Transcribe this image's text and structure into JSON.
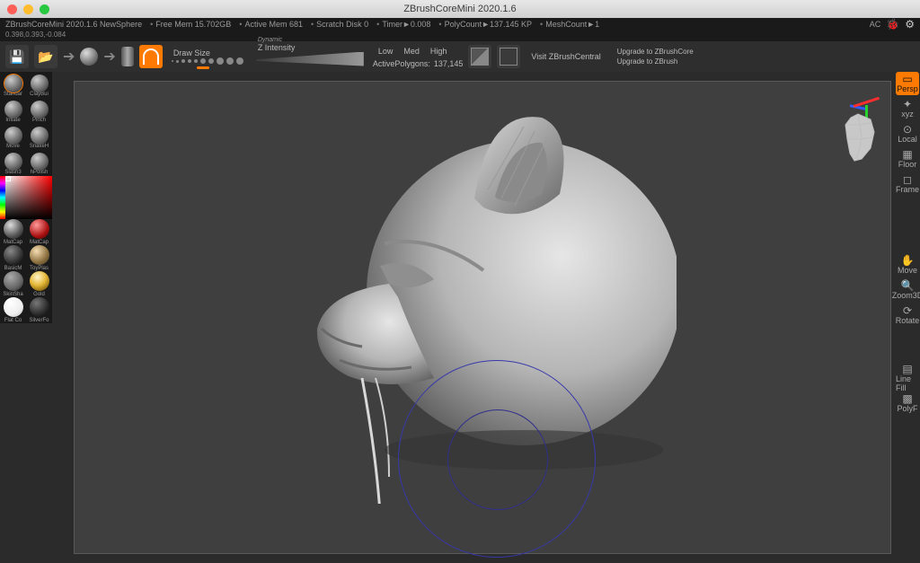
{
  "window": {
    "title": "ZBrushCoreMini 2020.1.6"
  },
  "infobar": {
    "app": "ZBrushCoreMini 2020.1.6 NewSphere",
    "mem": "Free Mem 15.702GB",
    "active": "Active Mem 681",
    "scratch": "Scratch Disk 0",
    "timer": "Timer►0.008",
    "poly": "PolyCount►137.145 KP",
    "mesh": "MeshCount►1",
    "ac": "AC"
  },
  "coords": "0.398,0.393,-0.084",
  "toolbar": {
    "drawsize": "Draw Size",
    "dynamic": "Dynamic",
    "zintensity": "Z Intensity",
    "low": "Low",
    "med": "Med",
    "high": "High",
    "activepoly_label": "ActivePolygons:",
    "activepoly_value": "137,145",
    "visit": "Visit ZBrushCentral",
    "upgrade_core": "Upgrade to ZBrushCore",
    "upgrade_full": "Upgrade to ZBrush"
  },
  "brushes": [
    {
      "label": "Standar"
    },
    {
      "label": "ClayBui"
    },
    {
      "label": "Inflate"
    },
    {
      "label": "Pinch"
    },
    {
      "label": "Move"
    },
    {
      "label": "SnakeH"
    },
    {
      "label": "Slash3"
    },
    {
      "label": "hPolish"
    }
  ],
  "materials": [
    {
      "label": "MatCap",
      "cls": "m-gray"
    },
    {
      "label": "MatCap",
      "cls": "m-red"
    },
    {
      "label": "BasicM",
      "cls": "m-dark"
    },
    {
      "label": "ToyPlas",
      "cls": "m-tan"
    },
    {
      "label": "SkinSha",
      "cls": "m-mat"
    },
    {
      "label": "Gold",
      "cls": "m-gold"
    },
    {
      "label": "Flat Co",
      "cls": "m-white"
    },
    {
      "label": "SilverFo",
      "cls": "m-dk2"
    }
  ],
  "right": {
    "persp": "Persp",
    "xyz": "xyz",
    "local": "Local",
    "floor": "Floor",
    "frame": "Frame",
    "move": "Move",
    "zoom": "Zoom3D",
    "rotate": "Rotate",
    "linefill": "Line Fill",
    "polyf": "PolyF"
  }
}
